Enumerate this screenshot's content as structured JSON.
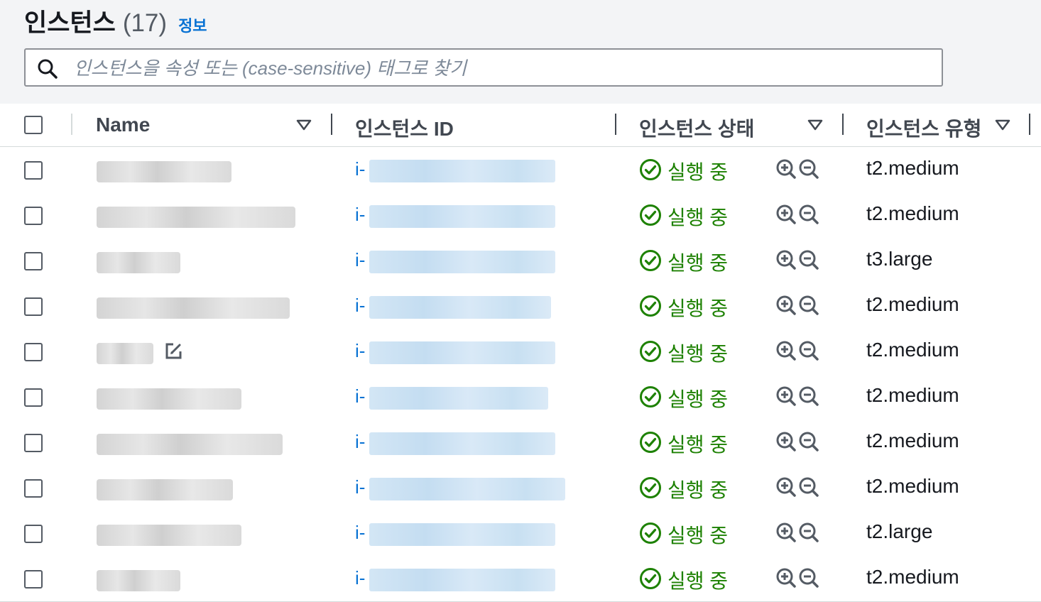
{
  "header": {
    "title": "인스턴스",
    "count": "(17)",
    "info_link": "정보"
  },
  "search": {
    "placeholder": "인스턴스을 속성 또는 (case-sensitive) 태그로 찾기",
    "value": ""
  },
  "columns": {
    "name": "Name",
    "instance_id": "인스턴스 ID",
    "instance_state": "인스턴스 상태",
    "instance_type": "인스턴스 유형"
  },
  "icons": {
    "search": "search-icon",
    "sort": "sort-down-icon",
    "status": "check-circle-icon",
    "zoom_in": "zoom-in-icon",
    "zoom_out": "zoom-out-icon",
    "edit": "edit-icon"
  },
  "colors": {
    "link": "#0972d3",
    "success": "#1d8102",
    "text": "#16191f",
    "header_bg": "#f3f4f6"
  },
  "rows": [
    {
      "id_prefix": "i-",
      "state": "실행 중",
      "type": "t2.medium"
    },
    {
      "id_prefix": "i-",
      "state": "실행 중",
      "type": "t2.medium"
    },
    {
      "id_prefix": "i-",
      "state": "실행 중",
      "type": "t3.large"
    },
    {
      "id_prefix": "i-",
      "state": "실행 중",
      "type": "t2.medium"
    },
    {
      "id_prefix": "i-",
      "state": "실행 중",
      "type": "t2.medium"
    },
    {
      "id_prefix": "i-",
      "state": "실행 중",
      "type": "t2.medium"
    },
    {
      "id_prefix": "i-",
      "state": "실행 중",
      "type": "t2.medium"
    },
    {
      "id_prefix": "i-",
      "state": "실행 중",
      "type": "t2.medium"
    },
    {
      "id_prefix": "i-",
      "state": "실행 중",
      "type": "t2.large"
    },
    {
      "id_prefix": "i-",
      "state": "실행 중",
      "type": "t2.medium"
    }
  ]
}
